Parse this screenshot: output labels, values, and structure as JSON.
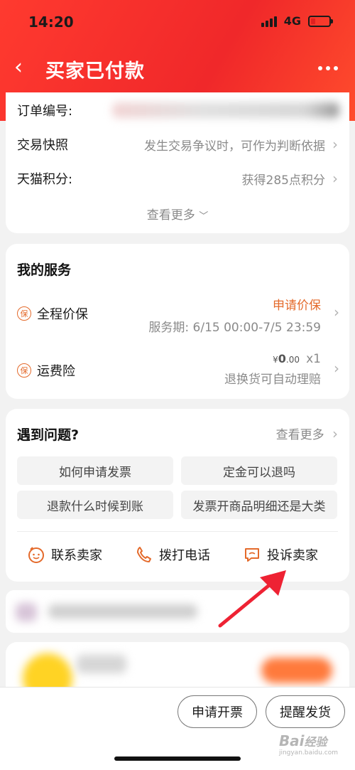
{
  "status_bar": {
    "time": "14:20",
    "network": "4G"
  },
  "nav": {
    "back_icon": "‹",
    "title": "买家已付款",
    "more_icon": "more-dots"
  },
  "order_info": {
    "order_no_label": "订单编号:",
    "snapshot_label": "交易快照",
    "snapshot_value": "发生交易争议时，可作为判断依据",
    "points_label": "天猫积分:",
    "points_value": "获得285点积分",
    "see_more": "查看更多"
  },
  "services": {
    "title": "我的服务",
    "badge_char": "保",
    "items": [
      {
        "name": "全程价保",
        "action": "申请价保",
        "detail": "服务期: 6/15 00:00-7/5 23:59"
      },
      {
        "name": "运费险",
        "price_symbol": "¥",
        "price": "0",
        "price_decimal": ".00",
        "quantity": "x1",
        "detail": "退换货可自动理赔"
      }
    ]
  },
  "problems": {
    "title": "遇到问题?",
    "see_more": "查看更多",
    "questions": [
      "如何申请发票",
      "定金可以退吗",
      "退款什么时候到账",
      "发票开商品明细还是大类"
    ],
    "actions": {
      "contact_seller": "联系卖家",
      "call": "拨打电话",
      "complain": "投诉卖家"
    }
  },
  "bottom_actions": {
    "invoice": "申请开票",
    "remind_ship": "提醒发货"
  },
  "watermark": {
    "brand": "Bai",
    "brand_suffix": "经验",
    "url": "jingyan.baidu.com"
  },
  "colors": {
    "header_red": "#f0282a",
    "accent_orange": "#e46a2b",
    "arrow_red": "#ee2233"
  }
}
